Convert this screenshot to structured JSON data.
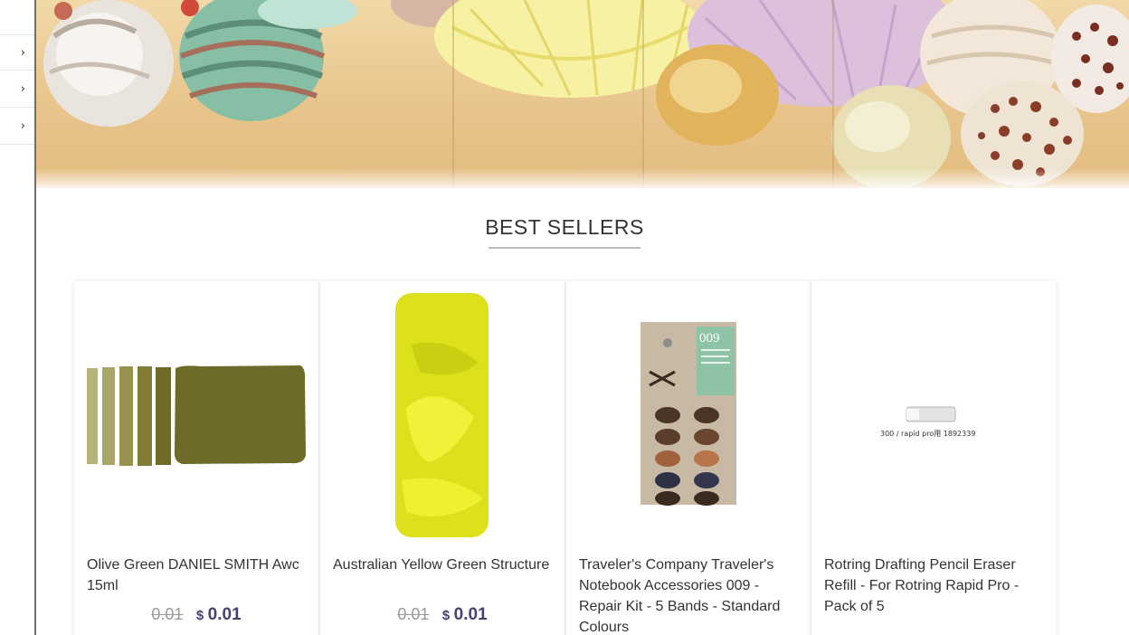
{
  "sidebar": {
    "items": [
      {
        "icon": "chevron-right-icon",
        "glyph": "›"
      },
      {
        "icon": "chevron-right-icon",
        "glyph": "›"
      },
      {
        "icon": "chevron-right-icon",
        "glyph": "›"
      }
    ]
  },
  "section": {
    "title": "BEST SELLERS"
  },
  "products": [
    {
      "name": "Olive Green DANIEL SMITH Awc 15ml",
      "old_price": "0.01",
      "currency": "$",
      "price": "0.01"
    },
    {
      "name": "Australian Yellow Green Structure",
      "old_price": "0.01",
      "currency": "$",
      "price": "0.01"
    },
    {
      "name": "Traveler's Company Traveler's Notebook Accessories 009 - Repair Kit - 5 Bands - Standard Colours",
      "kit_label": "009"
    },
    {
      "name": "Rotring Drafting Pencil Eraser Refill - For Rotring Rapid Pro - Pack of 5",
      "image_caption": "300 / rapid pro用   1892339"
    }
  ],
  "colors": {
    "price": "#4b3f72",
    "old_price": "#9a9a9a",
    "olive": "#6e6a2a",
    "yellow_green": "#d8e020"
  }
}
